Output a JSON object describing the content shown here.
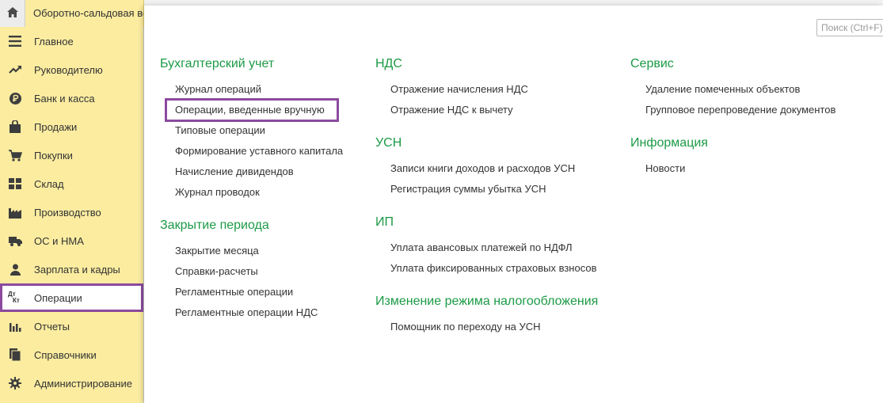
{
  "topbar": {
    "home_icon": "home-icon",
    "open_tab_title": "Оборотно-сальдовая ведомость"
  },
  "sidebar": {
    "items": [
      {
        "label": "Главное",
        "icon": "menu-lines-icon"
      },
      {
        "label": "Руководителю",
        "icon": "trend-up-icon"
      },
      {
        "label": "Банк и касса",
        "icon": "ruble-coin-icon"
      },
      {
        "label": "Продажи",
        "icon": "shopping-bag-icon"
      },
      {
        "label": "Покупки",
        "icon": "shopping-cart-icon"
      },
      {
        "label": "Склад",
        "icon": "warehouse-grid-icon"
      },
      {
        "label": "Производство",
        "icon": "factory-icon"
      },
      {
        "label": "ОС и НМА",
        "icon": "truck-icon"
      },
      {
        "label": "Зарплата и кадры",
        "icon": "person-icon"
      },
      {
        "label": "Операции",
        "icon": "debit-credit-icon",
        "icon_text_top": "Дт",
        "icon_text_bottom": "Кт"
      },
      {
        "label": "Отчеты",
        "icon": "bar-chart-icon"
      },
      {
        "label": "Справочники",
        "icon": "books-icon"
      },
      {
        "label": "Администрирование",
        "icon": "gear-icon"
      }
    ],
    "active_index": 9
  },
  "search": {
    "placeholder": "Поиск (Ctrl+F)"
  },
  "sections": {
    "accounting": {
      "title": "Бухгалтерский учет",
      "links": [
        "Журнал операций",
        "Операции, введенные вручную",
        "Типовые операции",
        "Формирование уставного капитала",
        "Начисление дивидендов",
        "Журнал проводок"
      ]
    },
    "closing": {
      "title": "Закрытие периода",
      "links": [
        "Закрытие месяца",
        "Справки-расчеты",
        "Регламентные операции",
        "Регламентные операции НДС"
      ]
    },
    "vat": {
      "title": "НДС",
      "links": [
        "Отражение начисления НДС",
        "Отражение НДС к вычету"
      ]
    },
    "usn": {
      "title": "УСН",
      "links": [
        "Записи книги доходов и расходов УСН",
        "Регистрация суммы убытка УСН"
      ]
    },
    "ip": {
      "title": "ИП",
      "links": [
        "Уплата авансовых платежей по НДФЛ",
        "Уплата фиксированных страховых взносов"
      ]
    },
    "taxmode": {
      "title": "Изменение режима налогообложения",
      "links": [
        "Помощник по переходу на УСН"
      ]
    },
    "service": {
      "title": "Сервис",
      "links": [
        "Удаление помеченных объектов",
        "Групповое перепроведение документов"
      ]
    },
    "info": {
      "title": "Информация",
      "links": [
        "Новости"
      ]
    }
  },
  "colors": {
    "sidebar_bg": "#fbeca0",
    "section_title": "#1c9a46",
    "highlight_box": "#8c4a9e"
  }
}
